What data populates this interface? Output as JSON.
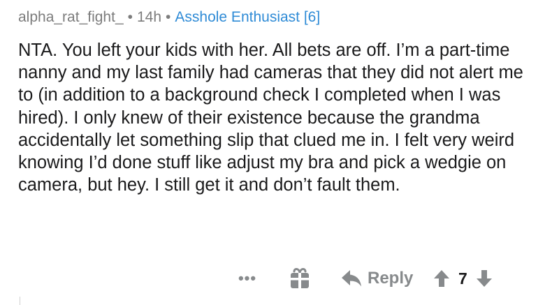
{
  "comment": {
    "author": "alpha_rat_fight_",
    "separator": "•",
    "time_ago": "14h",
    "flair": "Asshole Enthusiast [6]",
    "body": "NTA. You left your kids with her. All bets are off. I’m a part-time nanny and my last family had cameras that they did not alert me to (in addition to a background check I completed when I was hired). I only knew of their existence because the grandma accidentally let something slip that clued me in. I felt very weird knowing I’d done stuff like adjust my bra and pick a wedgie on camera, but hey. I still get it and don’t fault them."
  },
  "actions": {
    "more_label": "•••",
    "reply_label": "Reply",
    "score": "7"
  },
  "colors": {
    "text": "#1a1a1b",
    "meta": "#7c7c7c",
    "flair": "#2f8bd6",
    "icon": "#878a8c"
  },
  "icons": {
    "more": "more-options-icon",
    "gift": "gift-icon",
    "reply": "reply-arrow-icon",
    "upvote": "upvote-arrow-icon",
    "downvote": "downvote-arrow-icon"
  }
}
